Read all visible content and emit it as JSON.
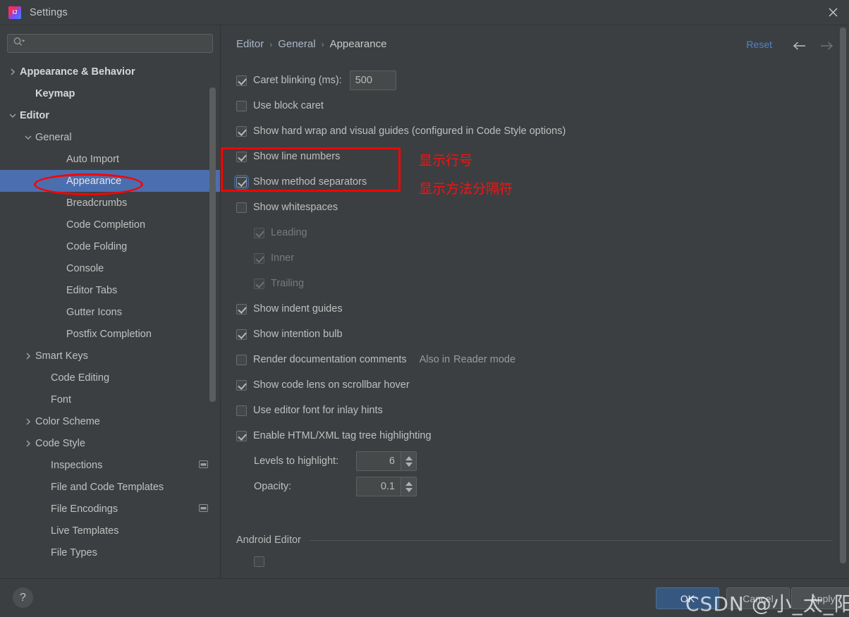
{
  "window": {
    "title": "Settings",
    "app_icon": "intellij-idea-icon",
    "close_icon": "close-icon"
  },
  "search": {
    "placeholder": "",
    "value": "",
    "icon": "search-icon"
  },
  "sidebar": {
    "items": [
      {
        "label": "Appearance & Behavior",
        "indent": 0,
        "arrow": "chevron-right",
        "bold": true,
        "selected": false,
        "trailing": ""
      },
      {
        "label": "Keymap",
        "indent": 0,
        "arrow": "none",
        "bold": true,
        "selected": false,
        "trailing": ""
      },
      {
        "label": "Editor",
        "indent": 0,
        "arrow": "chevron-down",
        "bold": true,
        "selected": false,
        "trailing": ""
      },
      {
        "label": "General",
        "indent": 1,
        "arrow": "chevron-down",
        "bold": false,
        "selected": false,
        "trailing": ""
      },
      {
        "label": "Auto Import",
        "indent": 2,
        "arrow": "none",
        "bold": false,
        "selected": false,
        "trailing": ""
      },
      {
        "label": "Appearance",
        "indent": 2,
        "arrow": "none",
        "bold": false,
        "selected": true,
        "trailing": ""
      },
      {
        "label": "Breadcrumbs",
        "indent": 2,
        "arrow": "none",
        "bold": false,
        "selected": false,
        "trailing": ""
      },
      {
        "label": "Code Completion",
        "indent": 2,
        "arrow": "none",
        "bold": false,
        "selected": false,
        "trailing": ""
      },
      {
        "label": "Code Folding",
        "indent": 2,
        "arrow": "none",
        "bold": false,
        "selected": false,
        "trailing": ""
      },
      {
        "label": "Console",
        "indent": 2,
        "arrow": "none",
        "bold": false,
        "selected": false,
        "trailing": ""
      },
      {
        "label": "Editor Tabs",
        "indent": 2,
        "arrow": "none",
        "bold": false,
        "selected": false,
        "trailing": ""
      },
      {
        "label": "Gutter Icons",
        "indent": 2,
        "arrow": "none",
        "bold": false,
        "selected": false,
        "trailing": ""
      },
      {
        "label": "Postfix Completion",
        "indent": 2,
        "arrow": "none",
        "bold": false,
        "selected": false,
        "trailing": ""
      },
      {
        "label": "Smart Keys",
        "indent": 1,
        "arrow": "chevron-right",
        "bold": false,
        "selected": false,
        "trailing": ""
      },
      {
        "label": "Code Editing",
        "indent": 1,
        "arrow": "none",
        "bold": false,
        "selected": false,
        "trailing": ""
      },
      {
        "label": "Font",
        "indent": 1,
        "arrow": "none",
        "bold": false,
        "selected": false,
        "trailing": ""
      },
      {
        "label": "Color Scheme",
        "indent": 1,
        "arrow": "chevron-right",
        "bold": false,
        "selected": false,
        "trailing": ""
      },
      {
        "label": "Code Style",
        "indent": 1,
        "arrow": "chevron-right",
        "bold": false,
        "selected": false,
        "trailing": ""
      },
      {
        "label": "Inspections",
        "indent": 1,
        "arrow": "none",
        "bold": false,
        "selected": false,
        "trailing": "project-scope-icon"
      },
      {
        "label": "File and Code Templates",
        "indent": 1,
        "arrow": "none",
        "bold": false,
        "selected": false,
        "trailing": ""
      },
      {
        "label": "File Encodings",
        "indent": 1,
        "arrow": "none",
        "bold": false,
        "selected": false,
        "trailing": "project-scope-icon"
      },
      {
        "label": "Live Templates",
        "indent": 1,
        "arrow": "none",
        "bold": false,
        "selected": false,
        "trailing": ""
      },
      {
        "label": "File Types",
        "indent": 1,
        "arrow": "none",
        "bold": false,
        "selected": false,
        "trailing": ""
      }
    ]
  },
  "header": {
    "breadcrumbs": [
      "Editor",
      "General",
      "Appearance"
    ],
    "separator": "›",
    "reset_label": "Reset",
    "back_icon": "arrow-left-icon",
    "forward_icon": "arrow-right-icon"
  },
  "options": {
    "caret_blinking": {
      "label": "Caret blinking (ms):",
      "checked": true,
      "value": "500"
    },
    "checkboxes": [
      {
        "label": "Use block caret",
        "checked": false,
        "enabled": true,
        "indent": false,
        "focused": false
      },
      {
        "label": "Show hard wrap and visual guides (configured in Code Style options)",
        "checked": true,
        "enabled": true,
        "indent": false,
        "focused": false
      },
      {
        "label": "Show line numbers",
        "checked": true,
        "enabled": true,
        "indent": false,
        "focused": false
      },
      {
        "label": "Show method separators",
        "checked": true,
        "enabled": true,
        "indent": false,
        "focused": true
      },
      {
        "label": "Show whitespaces",
        "checked": false,
        "enabled": true,
        "indent": false,
        "focused": false
      },
      {
        "label": "Leading",
        "checked": true,
        "enabled": false,
        "indent": true,
        "focused": false
      },
      {
        "label": "Inner",
        "checked": true,
        "enabled": false,
        "indent": true,
        "focused": false
      },
      {
        "label": "Trailing",
        "checked": true,
        "enabled": false,
        "indent": true,
        "focused": false
      },
      {
        "label": "Show indent guides",
        "checked": true,
        "enabled": true,
        "indent": false,
        "focused": false
      },
      {
        "label": "Show intention bulb",
        "checked": true,
        "enabled": true,
        "indent": false,
        "focused": false
      }
    ],
    "render_doc": {
      "label": "Render documentation comments",
      "checked": false,
      "side_text": "Also in",
      "side_link": "Reader mode"
    },
    "checkboxes_after": [
      {
        "label": "Show code lens on scrollbar hover",
        "checked": true,
        "enabled": true,
        "indent": false,
        "focused": false
      },
      {
        "label": "Use editor font for inlay hints",
        "checked": false,
        "enabled": true,
        "indent": false,
        "focused": false
      },
      {
        "label": "Enable HTML/XML tag tree highlighting",
        "checked": true,
        "enabled": true,
        "indent": false,
        "focused": false
      }
    ],
    "levels_to_highlight": {
      "label": "Levels to highlight:",
      "value": "6"
    },
    "opacity": {
      "label": "Opacity:",
      "value": "0.1"
    },
    "android_editor": {
      "label": "Android Editor"
    }
  },
  "buttons": {
    "help": "?",
    "ok": "OK",
    "cancel": "Cancel",
    "apply": "Apply"
  },
  "annotations": {
    "note_line_numbers": "显示行号",
    "note_method_separators": "显示方法分隔符",
    "highlight_color": "#ff0000",
    "watermark": "CSDN @小_太_阳"
  }
}
